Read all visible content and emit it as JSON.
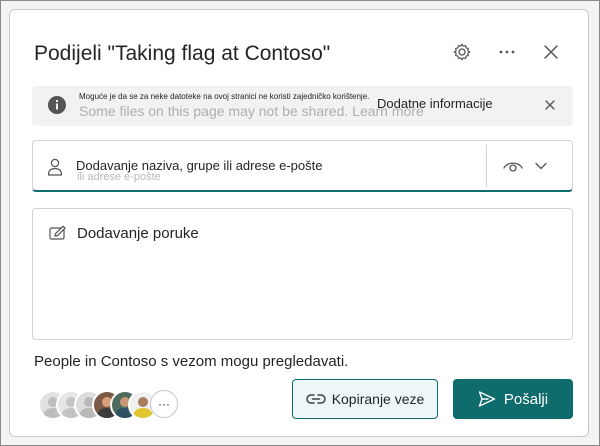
{
  "dialog": {
    "title": "Podijeli \"Taking flag at Contoso\""
  },
  "banner": {
    "ghost_text": "Some files on this page may not be shared. Learn more",
    "message": "Moguće je da se za neke datoteke na ovoj stranici ne koristi zajedničko korištenje.",
    "link_label": "Dodatne informacije"
  },
  "people": {
    "placeholder": "Dodavanje naziva, grupe ili adrese e-pošte",
    "ghost_text": "ili adrese e-pošte"
  },
  "message": {
    "placeholder": "Dodavanje poruke"
  },
  "permission_text": "People in Contoso s vezom mogu pregledavati.",
  "avatars": {
    "more_label": "···"
  },
  "buttons": {
    "copy_label": "Kopiranje veze",
    "send_label": "Pošalji"
  },
  "colors": {
    "accent": "#0f6c6c",
    "copy_bg": "#eef7f7"
  }
}
